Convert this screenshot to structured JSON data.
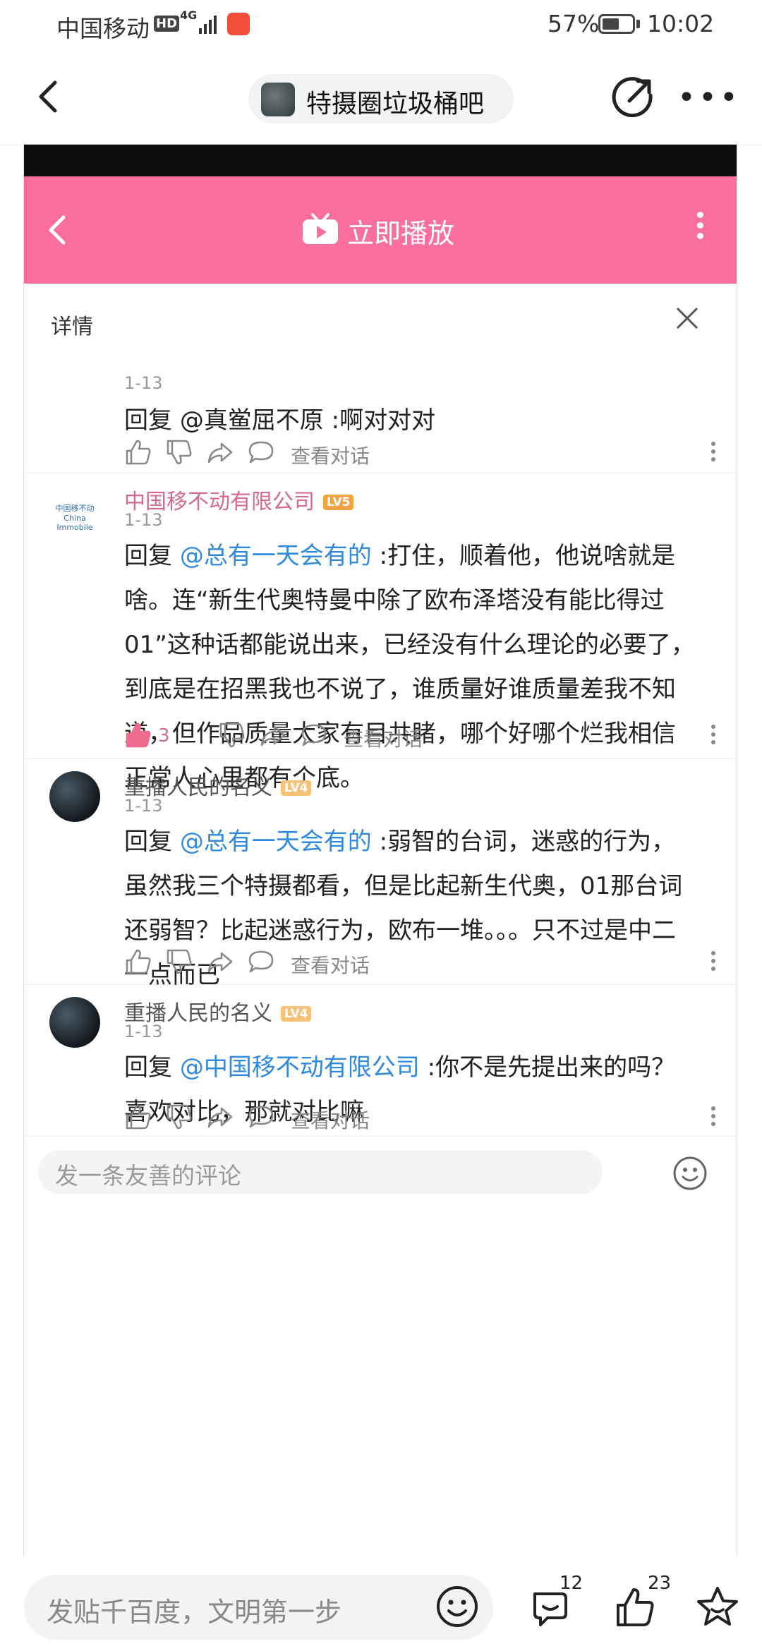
{
  "status_bar": {
    "carrier": "中国移动",
    "hd": "HD",
    "network": "4G",
    "battery": "57%",
    "battery_level": 0.57,
    "time": "10:02"
  },
  "nav": {
    "forum_name": "特摄圈垃圾桶吧"
  },
  "embedded": {
    "play_label": "立即播放",
    "detail_label": "详情",
    "comments": [
      {
        "user": "",
        "level": "",
        "date": "1-13",
        "reply_prefix": "回复 ",
        "mention": "@真鲎屈不原",
        "text": " :啊对对对",
        "likes": "",
        "view_conversation": "查看对话"
      },
      {
        "user": "中国移不动有限公司",
        "avatar_text": "中国移不动 China Immobile",
        "level": "LV5",
        "date": "1-13",
        "reply_prefix": "回复 ",
        "mention": "@总有一天会有的",
        "text": " :打住，顺着他，他说啥就是啥。连“新生代奥特曼中除了欧布泽塔没有能比得过01”这种话都能说出来，已经没有什么理论的必要了，到底是在招黑我也不说了，谁质量好谁质量差我不知道，但作品质量大家有目共睹，哪个好哪个烂我相信正常人心里都有个底。",
        "likes": "3",
        "view_conversation": "查看对话"
      },
      {
        "user": "重播人民的名义",
        "level": "LV4",
        "date": "1-13",
        "reply_prefix": "回复 ",
        "mention": "@总有一天会有的",
        "text": " :弱智的台词，迷惑的行为，虽然我三个特摄都看，但是比起新生代奥，01那台词还弱智？比起迷惑行为，欧布一堆。。。只不过是中二一点而已",
        "likes": "",
        "view_conversation": "查看对话"
      },
      {
        "user": "重播人民的名义",
        "level": "LV4",
        "date": "1-13",
        "reply_prefix": "回复 ",
        "mention": "@中国移不动有限公司",
        "text": " :你不是先提出来的吗？喜欢对比，那就对比嘛",
        "likes": "",
        "view_conversation": "查看对话"
      }
    ],
    "inner_input_placeholder": "发一条友善的评论"
  },
  "bottom_bar": {
    "input_placeholder": "发贴千百度，文明第一步",
    "comment_count": "12",
    "like_count": "23"
  },
  "colors": {
    "pink_bar": "#fb6f9f",
    "mention": "#2f8ae0",
    "username_pink": "#d6698c",
    "level5": "#f0a43f",
    "level4": "#f6c27a"
  }
}
